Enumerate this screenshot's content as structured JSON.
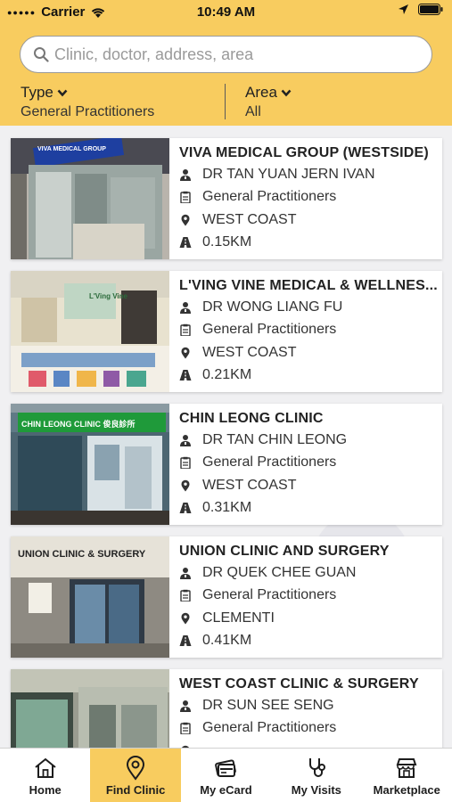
{
  "status": {
    "carrier": "Carrier",
    "time": "10:49 AM"
  },
  "search": {
    "placeholder": "Clinic, doctor, address, area"
  },
  "filters": {
    "type": {
      "title": "Type",
      "value": "General Practitioners"
    },
    "area": {
      "title": "Area",
      "value": "All"
    }
  },
  "clinics": [
    {
      "name": "VIVA MEDICAL GROUP (WESTSIDE)",
      "doctor": "DR TAN YUAN JERN IVAN",
      "specialty": "General Practitioners",
      "area": "WEST COAST",
      "distance": "0.15KM",
      "sign": "VIVA MEDICAL GROUP"
    },
    {
      "name": "L'VING VINE MEDICAL & WELLNES...",
      "doctor": "DR WONG LIANG FU",
      "specialty": "General Practitioners",
      "area": "WEST COAST",
      "distance": "0.21KM",
      "sign": "L'Ving Vine"
    },
    {
      "name": "CHIN LEONG CLINIC",
      "doctor": "DR TAN CHIN LEONG",
      "specialty": "General Practitioners",
      "area": "WEST COAST",
      "distance": "0.31KM",
      "sign": "CHIN LEONG CLINIC 俊良診所"
    },
    {
      "name": "UNION CLINIC AND SURGERY",
      "doctor": "DR QUEK CHEE GUAN",
      "specialty": "General Practitioners",
      "area": "CLEMENTI",
      "distance": "0.41KM",
      "sign": "UNION CLINIC & SURGERY"
    },
    {
      "name": "WEST COAST CLINIC & SURGERY",
      "doctor": "DR SUN SEE SENG",
      "specialty": "General Practitioners",
      "area": "",
      "distance": "",
      "sign": ""
    }
  ],
  "tabs": [
    {
      "label": "Home",
      "icon": "home-icon",
      "active": false
    },
    {
      "label": "Find Clinic",
      "icon": "location-pin-icon",
      "active": true
    },
    {
      "label": "My eCard",
      "icon": "ecard-icon",
      "active": false
    },
    {
      "label": "My Visits",
      "icon": "stethoscope-icon",
      "active": false
    },
    {
      "label": "Marketplace",
      "icon": "store-icon",
      "active": false
    }
  ],
  "colors": {
    "accent": "#f8cc5f",
    "background": "#f1f1f3"
  }
}
